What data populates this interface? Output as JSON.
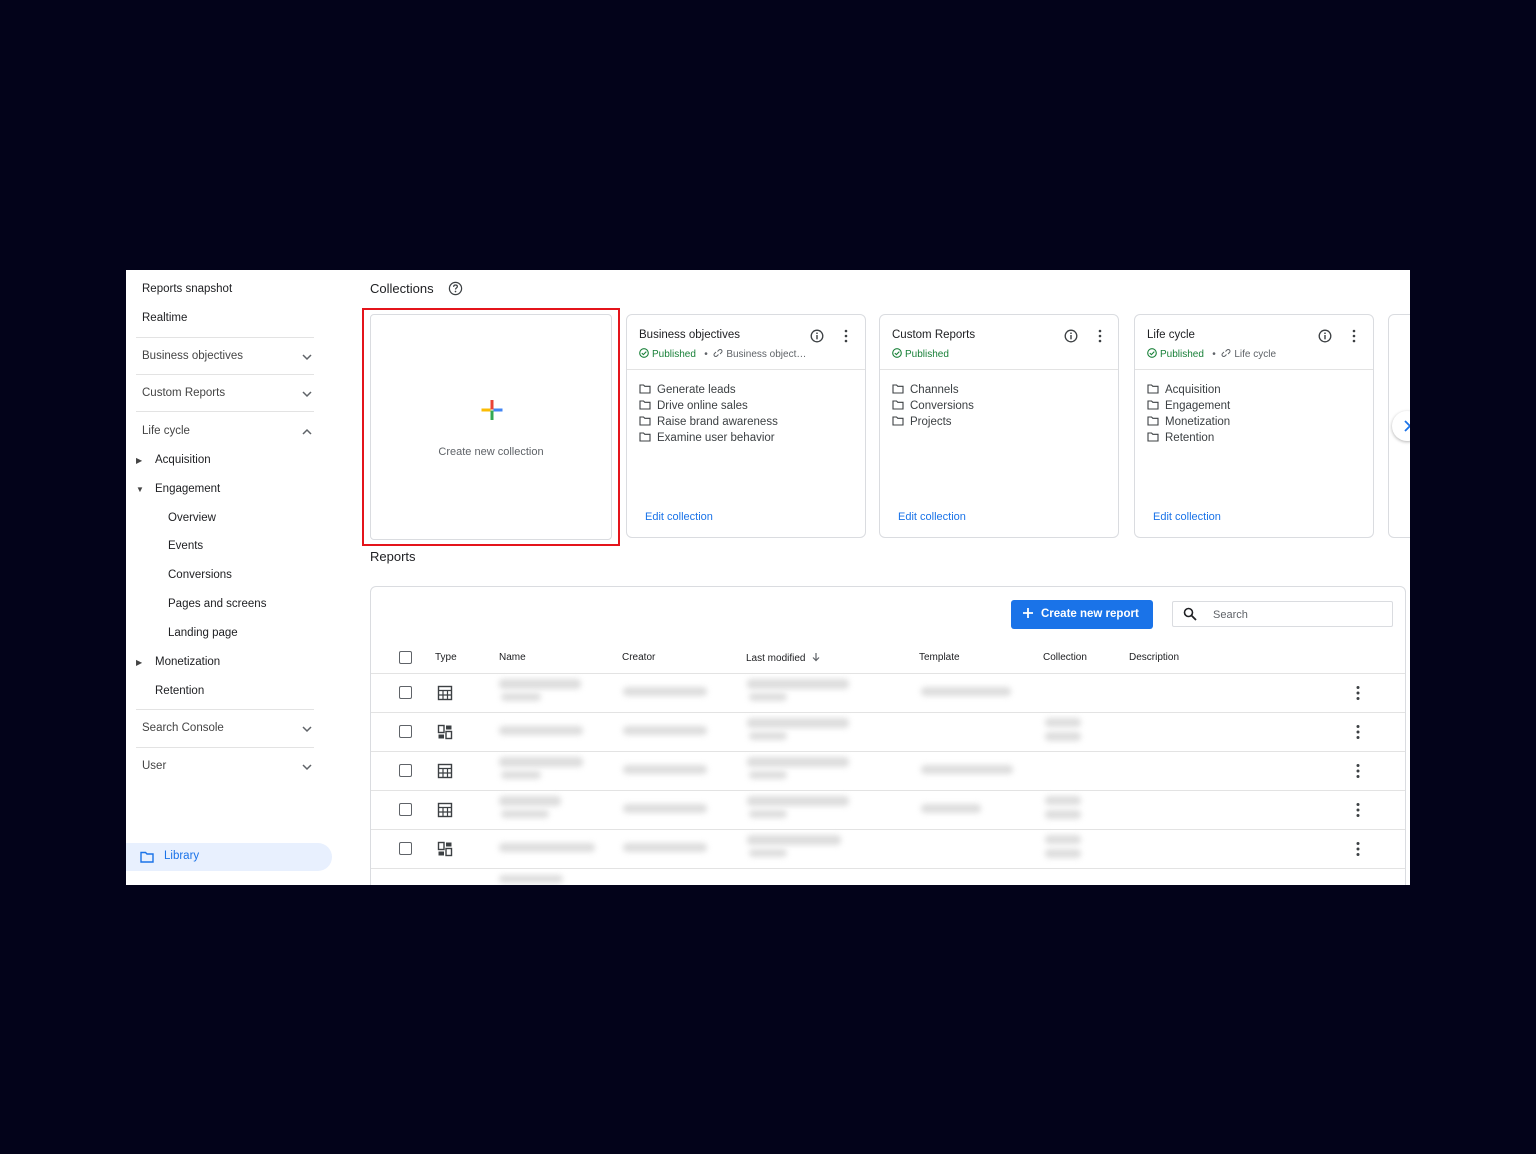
{
  "sidebar": {
    "top_items": [
      "Reports snapshot",
      "Realtime"
    ],
    "sections": {
      "business_objectives": "Business objectives",
      "custom_reports": "Custom Reports",
      "life_cycle": "Life cycle",
      "search_console": "Search Console",
      "user": "User"
    },
    "life_cycle_items": {
      "acquisition": "Acquisition",
      "engagement": "Engagement",
      "monetization": "Monetization",
      "retention": "Retention"
    },
    "engagement_items": [
      "Overview",
      "Events",
      "Conversions",
      "Pages and screens",
      "Landing page"
    ],
    "library": "Library"
  },
  "collections": {
    "title": "Collections",
    "create_label": "Create new collection",
    "cards": [
      {
        "title": "Business objectives",
        "status": "Published",
        "template": "Business object…",
        "items": [
          "Generate leads",
          "Drive online sales",
          "Raise brand awareness",
          "Examine user behavior"
        ],
        "edit": "Edit collection"
      },
      {
        "title": "Custom Reports",
        "status": "Published",
        "template": "",
        "items": [
          "Channels",
          "Conversions",
          "Projects"
        ],
        "edit": "Edit collection"
      },
      {
        "title": "Life cycle",
        "status": "Published",
        "template": "Life cycle",
        "items": [
          "Acquisition",
          "Engagement",
          "Monetization",
          "Retention"
        ],
        "edit": "Edit collection"
      }
    ]
  },
  "reports": {
    "title": "Reports",
    "create_button": "Create new report",
    "search_placeholder": "Search",
    "columns": {
      "type": "Type",
      "name": "Name",
      "creator": "Creator",
      "last_modified": "Last modified",
      "template": "Template",
      "collection": "Collection",
      "description": "Description"
    },
    "row_types": [
      "table",
      "dashboard",
      "table",
      "table",
      "dashboard"
    ]
  },
  "colors": {
    "accent": "#1a73e8",
    "published": "#188038",
    "highlight": "#e4141b",
    "backdrop": "#03031a"
  }
}
